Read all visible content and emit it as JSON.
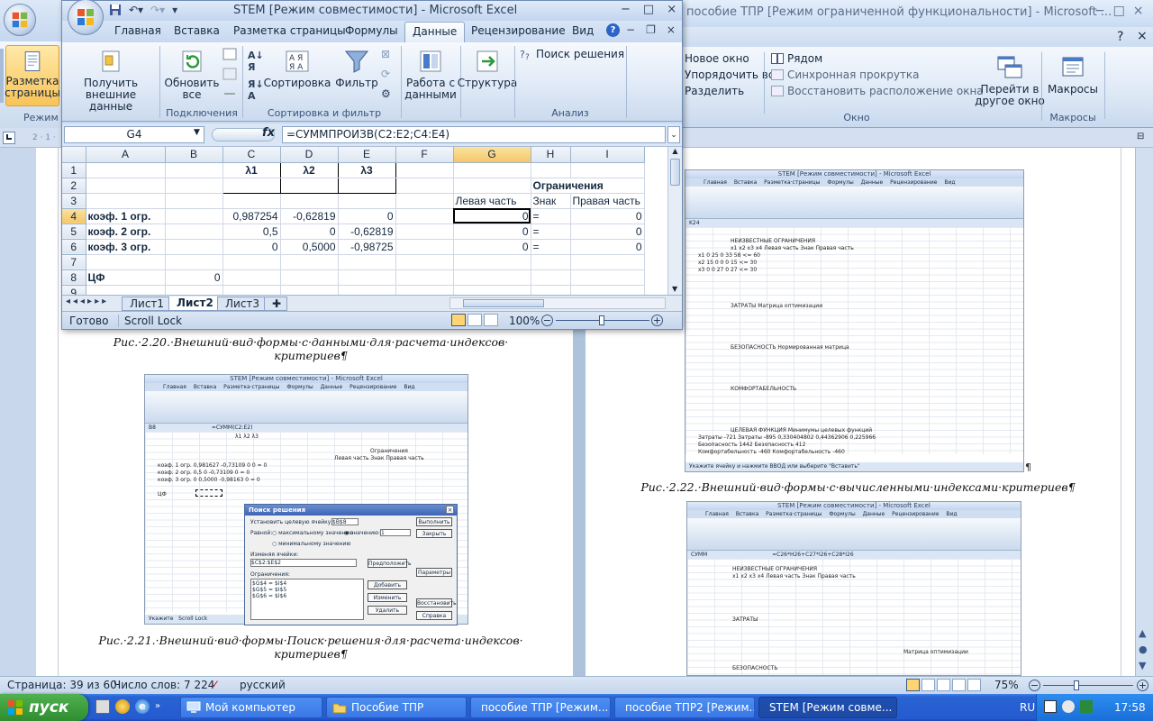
{
  "word": {
    "title": "пособие ТПР [Режим ограниченной функциональности] - Microsoft ...",
    "ribbon": {
      "new_window": "Новое окно",
      "arrange_all": "Упорядочить все",
      "split": "Разделить",
      "side_by_side": "Рядом",
      "sync_scroll": "Синхронная прокрутка",
      "reset_position": "Восстановить расположение окна",
      "switch_windows": "Перейти в другое окно",
      "macros": "Макросы",
      "group_window": "Окно",
      "group_macros": "Макросы",
      "partial_left_label": "Разметка страницы",
      "partial_left_group": "Режим"
    },
    "caption_220": "Рис.·2.20.·Внешний·вид·формы·с·данными·для·расчета·индексов· критериев¶",
    "caption_221": "Рис.·2.21.·Внешний·вид·формы·Поиск·решения·для·расчета·индексов· критериев¶",
    "caption_222": "Рис.·2.22.·Внешний·вид·формы·с·вычисленными·индексами·критериев¶",
    "status": {
      "page": "Страница: 39 из 60",
      "words": "Число слов: 7 224",
      "language": "русский",
      "zoom": "75%"
    }
  },
  "excel": {
    "title": "STEM  [Режим совместимости] - Microsoft Excel",
    "tabs": [
      "Главная",
      "Вставка",
      "Разметка страницы",
      "Формулы",
      "Данные",
      "Рецензирование",
      "Вид"
    ],
    "active_tab": "Данные",
    "ribbon": {
      "get_external": "Получить внешние данные",
      "refresh_all": "Обновить все",
      "group_connections": "Подключения",
      "sort": "Сортировка",
      "filter": "Фильтр",
      "group_sort_filter": "Сортировка и фильтр",
      "data_tools": "Работа с данными",
      "outline": "Структура",
      "solver": "Поиск решения",
      "group_analysis": "Анализ"
    },
    "name_box": "G4",
    "fx": "fx",
    "formula": "=СУММПРОИЗВ(C2:E2;C4:E4)",
    "columns": [
      "A",
      "B",
      "C",
      "D",
      "E",
      "F",
      "G",
      "H",
      "I"
    ],
    "rows": [
      {
        "n": "1",
        "c": "λ1",
        "d": "λ2",
        "e": "λ3"
      },
      {
        "n": "2",
        "h": "Ограничения"
      },
      {
        "n": "3",
        "g": "Левая часть",
        "h": "Знак",
        "i": "Правая часть"
      },
      {
        "n": "4",
        "a": "коэф. 1 огр.",
        "c": "0,987254",
        "d": "-0,62819",
        "e": "0",
        "g": "0",
        "h": "=",
        "i": "0"
      },
      {
        "n": "5",
        "a": "коэф. 2 огр.",
        "c": "0,5",
        "d": "0",
        "e": "-0,62819",
        "g": "0",
        "h": "=",
        "i": "0"
      },
      {
        "n": "6",
        "a": "коэф. 3 огр.",
        "c": "0",
        "d": "0,5000",
        "e": "-0,98725",
        "g": "0",
        "h": "=",
        "i": "0"
      },
      {
        "n": "7"
      },
      {
        "n": "8",
        "a": "ЦФ",
        "b": "0"
      },
      {
        "n": "9"
      }
    ],
    "sheets": [
      "Лист1",
      "Лист2",
      "Лист3"
    ],
    "active_sheet": "Лист2",
    "status": {
      "ready": "Готово",
      "scroll_lock": "Scroll Lock",
      "zoom": "100%"
    }
  },
  "thumb21": {
    "title": "STEM  [Режим совместимости] - Microsoft Excel",
    "tabs": "Главная Вставка Разметка·страницы Формулы Данные Рецензирование Вид",
    "namebox": "B8",
    "formula": "=СУММ(C2:E2)",
    "rows": [
      "λ1        λ2        λ3",
      "Ограничения",
      "Левая часть  Знак  Правая часть",
      "коэф. 1 огр.   0,981627  -0,73109   0     0 =    0",
      "коэф. 2 огр.   0,5   0   -0,73109     0 =    0",
      "коэф. 3 огр.   0   0,5000   -0,98163     0 =    0",
      "ЦФ"
    ],
    "dialog": {
      "title": "Поиск решения",
      "target": "Установить целевую ячейку:",
      "target_value": "$B$8",
      "equal": "Равной:",
      "max": "максимальному значению",
      "value": "значению:",
      "value_num": "1",
      "min": "минимальному значению",
      "changing": "Изменяя ячейки:",
      "changing_value": "$C$2:$E$2",
      "constraints": "Ограничения:",
      "c1": "$G$4 = $I$4",
      "c2": "$G$5 = $I$5",
      "c3": "$G$6 = $I$6",
      "btn_run": "Выполнить",
      "btn_close": "Закрыть",
      "btn_guess": "Предположить",
      "btn_params": "Параметры",
      "btn_add": "Добавить",
      "btn_change": "Изменить",
      "btn_restore": "Восстановить",
      "btn_delete": "Удалить",
      "btn_help": "Справка"
    }
  },
  "thumb22": {
    "title": "STEM  [Режим совместимости] - Microsoft Excel",
    "namebox": "K24",
    "rows": [
      "НЕИЗВЕСТНЫЕ                              ОГРАНИЧЕНИЯ",
      "x1   x2   x3   x4          Левая часть  Знак  Правая часть",
      "x1    0   25   0   33        58 <=       60",
      "x2   15    0   0    0        15 <=       30",
      "x3    0    0  27    0        27 <=       30",
      "ЗАТРАТЫ                      Матрица оптимизации",
      "БЕЗОПАСНОСТЬ                 Нормированная матрица",
      "КОМФОРТАБЕЛЬНОСТЬ",
      "ЦЕЛЕВАЯ ФУНКЦИЯ        Минимумы целевых функций",
      "Затраты      -721      Затраты       -895  0,330404802  0,44362906  0,225966",
      "Безопасность  1442     Безопасность  412",
      "Комфортабельность -460  Комфортабельность -460"
    ],
    "status": "Укажите ячейку и нажмите ВВОД или выберите \"Вставить\""
  },
  "thumb23": {
    "title": "STEM  [Режим совместимости] - Microsoft Excel",
    "namebox": "СУММ",
    "formula": "=C26*H26+C27*I26+C28*I26",
    "rows": [
      "НЕИЗВЕСТНЫЕ                      ОГРАНИЧЕНИЯ",
      "x1   x2   x3   x4     Левая часть  Знак  Правая часть",
      "ЗАТРАТЫ",
      "Матрица оптимизации",
      "БЕЗОПАСНОСТЬ"
    ]
  },
  "taskbar": {
    "start": "пуск",
    "tasks": [
      "Мой компьютер",
      "Пособие ТПР",
      "пособие ТПР [Режим...",
      "пособие ТПР2 [Режим...",
      "STEM  [Режим совме..."
    ],
    "lang": "RU",
    "time": "17:58"
  },
  "colors": {
    "excel_accent": "#c8d8ee",
    "taskbar": "#245bd0",
    "start": "#3a9a3a"
  }
}
